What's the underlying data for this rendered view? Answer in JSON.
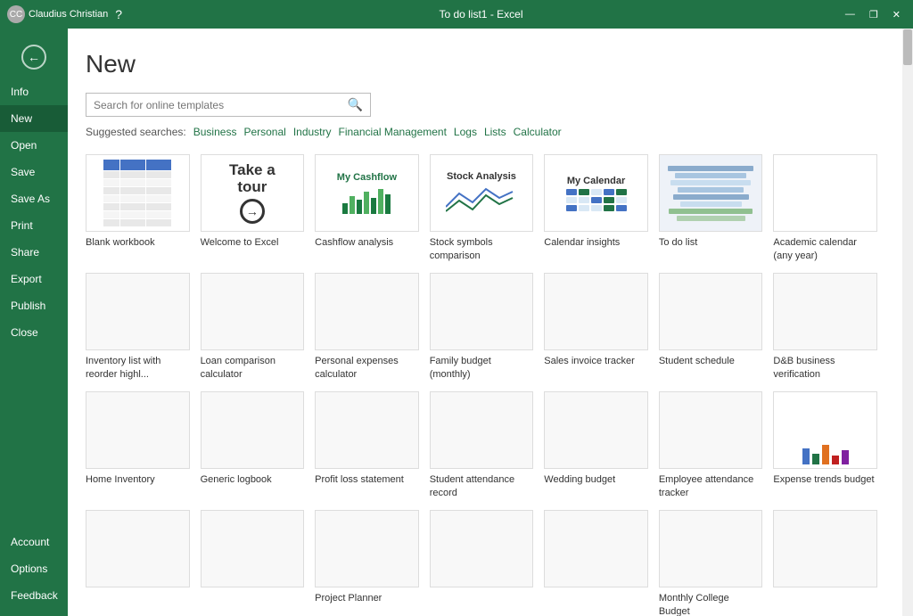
{
  "titleBar": {
    "title": "To do list1 - Excel",
    "user": "Claudius Christian",
    "controls": [
      "—",
      "❐",
      "✕"
    ]
  },
  "sidebar": {
    "backIcon": "←",
    "items": [
      {
        "label": "Info",
        "id": "info",
        "active": false
      },
      {
        "label": "New",
        "id": "new",
        "active": true
      },
      {
        "label": "Open",
        "id": "open",
        "active": false
      },
      {
        "label": "Save",
        "id": "save",
        "active": false
      },
      {
        "label": "Save As",
        "id": "save-as",
        "active": false
      },
      {
        "label": "Print",
        "id": "print",
        "active": false
      },
      {
        "label": "Share",
        "id": "share",
        "active": false
      },
      {
        "label": "Export",
        "id": "export",
        "active": false
      },
      {
        "label": "Publish",
        "id": "publish",
        "active": false
      },
      {
        "label": "Close",
        "id": "close",
        "active": false
      }
    ],
    "bottomItems": [
      {
        "label": "Account",
        "id": "account"
      },
      {
        "label": "Options",
        "id": "options"
      },
      {
        "label": "Feedback",
        "id": "feedback"
      }
    ]
  },
  "content": {
    "title": "New",
    "search": {
      "placeholder": "Search for online templates",
      "icon": "🔍"
    },
    "suggestedLabel": "Suggested searches:",
    "suggestedTags": [
      "Business",
      "Personal",
      "Industry",
      "Financial Management",
      "Logs",
      "Lists",
      "Calculator"
    ],
    "templates": [
      {
        "id": "blank",
        "name": "Blank workbook",
        "type": "blank"
      },
      {
        "id": "tour",
        "name": "Welcome to Excel",
        "type": "tour",
        "text1": "Take a",
        "text2": "tour"
      },
      {
        "id": "cashflow",
        "name": "Cashflow analysis",
        "type": "cashflow",
        "title": "My Cashflow"
      },
      {
        "id": "stock",
        "name": "Stock symbols comparison",
        "type": "stock",
        "title": "Stock Analysis"
      },
      {
        "id": "calendar",
        "name": "Calendar insights",
        "type": "calendar",
        "title": "My Calendar"
      },
      {
        "id": "todo",
        "name": "To do list",
        "type": "todo"
      },
      {
        "id": "academic",
        "name": "Academic calendar (any year)",
        "type": "academic"
      },
      {
        "id": "inventory",
        "name": "Inventory list with reorder highl...",
        "type": "generic-green"
      },
      {
        "id": "loan",
        "name": "Loan comparison calculator",
        "type": "generic-olive"
      },
      {
        "id": "expenses",
        "name": "Personal expenses calculator",
        "type": "generic-dark"
      },
      {
        "id": "family-budget",
        "name": "Family budget (monthly)",
        "type": "generic-light"
      },
      {
        "id": "sales",
        "name": "Sales invoice tracker",
        "type": "generic-teal"
      },
      {
        "id": "student",
        "name": "Student schedule",
        "type": "generic-blue-teal"
      },
      {
        "id": "dab",
        "name": "D&B business verification",
        "type": "generic-blue"
      },
      {
        "id": "home-inv",
        "name": "Home Inventory",
        "type": "generic-cyan"
      },
      {
        "id": "logbook",
        "name": "Generic logbook",
        "type": "generic-dark2"
      },
      {
        "id": "profit",
        "name": "Profit loss statement",
        "type": "generic-orange"
      },
      {
        "id": "attendance",
        "name": "Student attendance record",
        "type": "generic-blue2"
      },
      {
        "id": "wedding",
        "name": "Wedding budget",
        "type": "generic-green2"
      },
      {
        "id": "emp-attend",
        "name": "Employee attendance tracker",
        "type": "generic-multi"
      },
      {
        "id": "expense-trend",
        "name": "Expense trends budget",
        "type": "generic-chart"
      },
      {
        "id": "r1",
        "name": "",
        "type": "generic-green3"
      },
      {
        "id": "r2",
        "name": "",
        "type": "generic-simple"
      },
      {
        "id": "r3",
        "name": "Project Planner",
        "type": "generic-planner"
      },
      {
        "id": "r4",
        "name": "",
        "type": "generic-orange2"
      },
      {
        "id": "r5",
        "name": "",
        "type": "generic-list"
      },
      {
        "id": "r6",
        "name": "Monthly College Budget",
        "type": "generic-budget"
      },
      {
        "id": "r7",
        "name": "",
        "type": "generic-yellow"
      }
    ]
  }
}
